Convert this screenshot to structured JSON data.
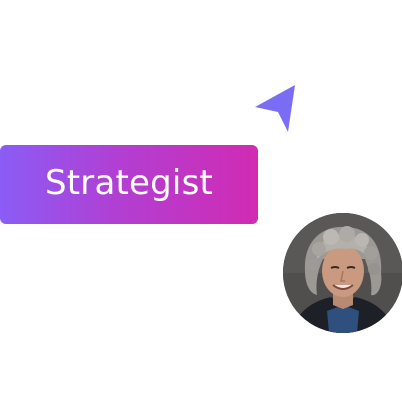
{
  "role": {
    "label": "Strategist"
  },
  "colors": {
    "gradient_start": "#8b5cf6",
    "gradient_mid": "#b13fd3",
    "gradient_end": "#d12bb3",
    "cursor": "#7b6cf4"
  },
  "icons": {
    "cursor": "cursor-pointer-icon"
  },
  "avatar": {
    "description_name": "profile-avatar"
  }
}
